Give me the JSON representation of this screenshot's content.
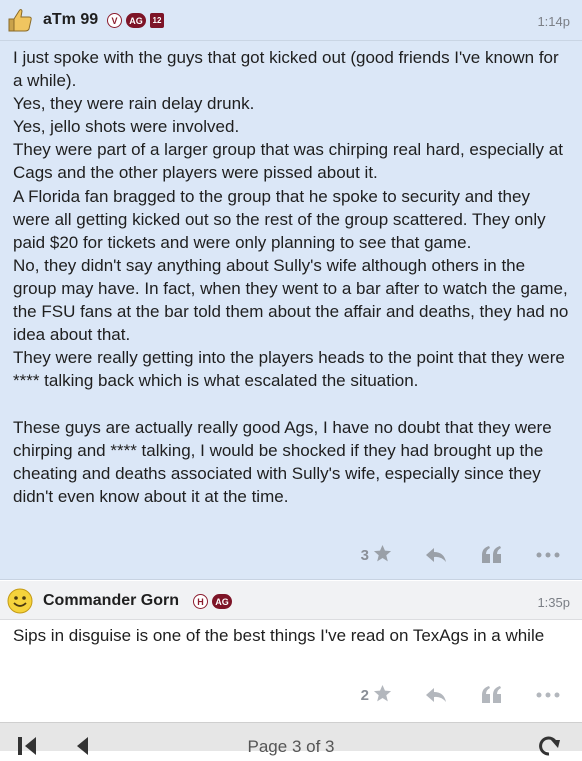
{
  "posts": [
    {
      "username": "aTm 99",
      "badges": [
        "V",
        "AG",
        "12"
      ],
      "time": "1:14p",
      "body": "I just spoke with the guys that got kicked out (good friends I've known for a while).\nYes, they were rain delay drunk.\nYes, jello shots were involved.\nThey were part of a larger group that was chirping real hard, especially at Cags and the other players were pissed about it.\nA Florida fan bragged to the group that he spoke to security and they were all getting kicked out so the rest of the group scattered. They only paid $20 for tickets and were only planning to see that game.\nNo, they didn't say anything about Sully's wife although others in the group may have. In fact, when they went to a bar after to watch the game, the FSU fans at the bar told them about the affair and deaths, they had no idea about that.\nThey were really getting into the players heads to the point that they were **** talking back which is what escalated the situation.\n\nThese guys are actually really good Ags, I have no doubt that they were chirping and **** talking, I would be shocked if they had brought up the cheating and deaths associated with Sully's wife, especially since they didn't even know about it at the time.",
      "likes": "3"
    },
    {
      "username": "Commander Gorn",
      "badges": [
        "H",
        "AG"
      ],
      "time": "1:35p",
      "body": "Sips in disguise is one of the best things I've read on TexAgs in a while",
      "likes": "2"
    }
  ],
  "footer": {
    "page_label": "Page 3 of 3"
  },
  "icons": {
    "avatar1": "thumbs-up-icon",
    "avatar2": "smiley-icon",
    "like": "star-icon",
    "reply": "reply-arrow-icon",
    "quote": "quote-icon",
    "more": "ellipsis-icon",
    "first": "first-page-icon",
    "prev": "previous-page-icon",
    "refresh": "refresh-icon"
  },
  "colors": {
    "post_highlight": "#dbe7f7",
    "aggie_maroon": "#7d1427"
  }
}
